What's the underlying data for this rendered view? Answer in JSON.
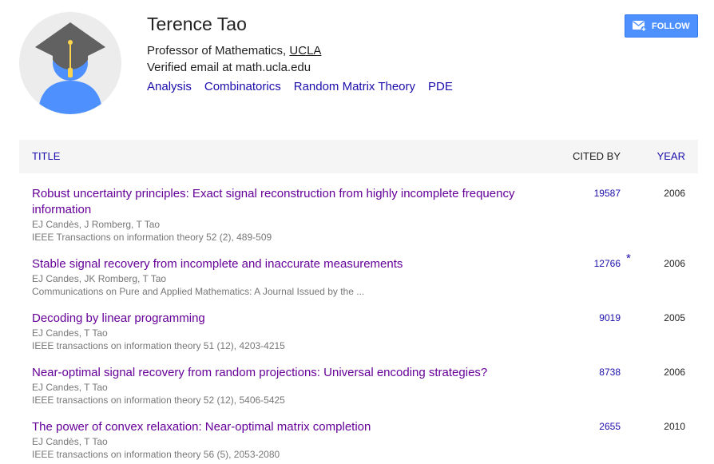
{
  "profile": {
    "name": "Terence Tao",
    "title_prefix": "Professor of Mathematics, ",
    "affiliation_link": "UCLA",
    "email": "Verified email at math.ucla.edu",
    "interests": [
      "Analysis",
      "Combinatorics",
      "Random Matrix Theory",
      "PDE"
    ],
    "avatar_icon": "graduate-cap-avatar-icon"
  },
  "follow_button": {
    "label": "FOLLOW",
    "icon": "email-add-icon",
    "color": "#4d90fe"
  },
  "table": {
    "headers": {
      "title": "TITLE",
      "cited_by": "CITED BY",
      "year": "YEAR"
    },
    "rows": [
      {
        "title": "Robust uncertainty principles: Exact signal reconstruction from highly incomplete frequency information",
        "authors": "EJ Candès, J Romberg, T Tao",
        "venue": "IEEE Transactions on information theory 52 (2), 489-509",
        "cited_by": "19587",
        "star": "",
        "year": "2006"
      },
      {
        "title": "Stable signal recovery from incomplete and inaccurate measurements",
        "authors": "EJ Candes, JK Romberg, T Tao",
        "venue": "Communications on Pure and Applied Mathematics: A Journal Issued by the ...",
        "cited_by": "12766",
        "star": "*",
        "year": "2006"
      },
      {
        "title": "Decoding by linear programming",
        "authors": "EJ Candes, T Tao",
        "venue": "IEEE transactions on information theory 51 (12), 4203-4215",
        "cited_by": "9019",
        "star": "",
        "year": "2005"
      },
      {
        "title": "Near-optimal signal recovery from random projections: Universal encoding strategies?",
        "authors": "EJ Candes, T Tao",
        "venue": "IEEE transactions on information theory 52 (12), 5406-5425",
        "cited_by": "8738",
        "star": "",
        "year": "2006"
      },
      {
        "title": "The power of convex relaxation: Near-optimal matrix completion",
        "authors": "EJ Candès, T Tao",
        "venue": "IEEE transactions on information theory 56 (5), 2053-2080",
        "cited_by": "2655",
        "star": "",
        "year": "2010"
      }
    ]
  }
}
